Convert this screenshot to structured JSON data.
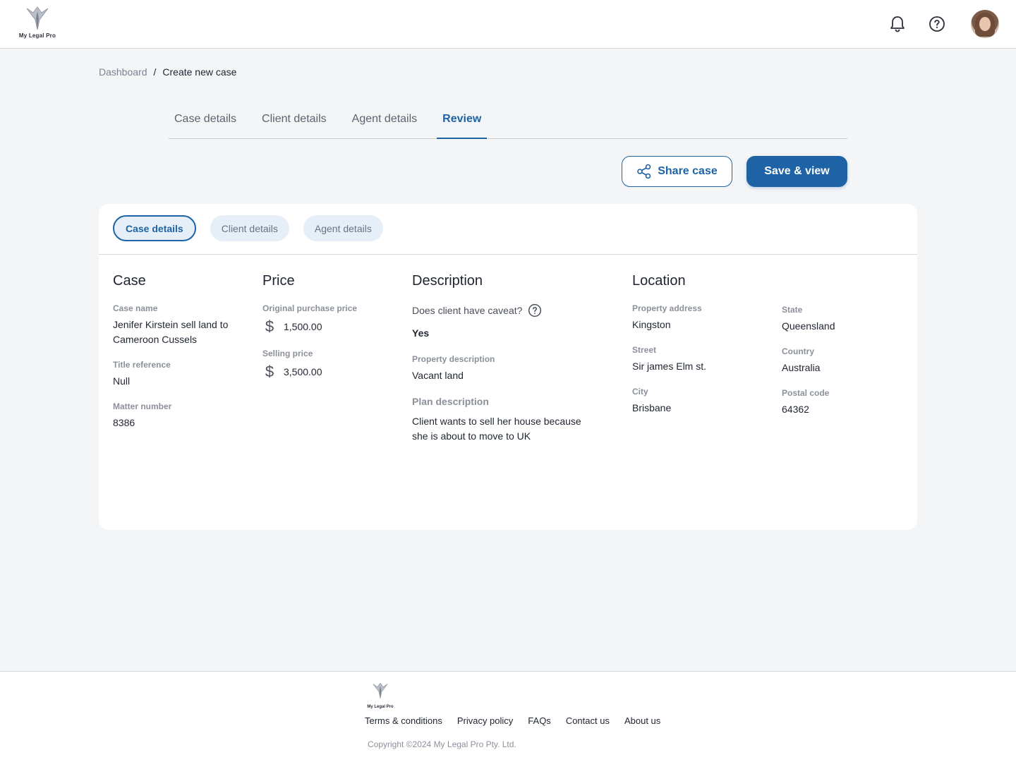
{
  "header": {
    "logo_text": "My Legal Pro",
    "icons": [
      "bell-icon",
      "help-icon",
      "avatar"
    ]
  },
  "breadcrumb": {
    "parent": "Dashboard",
    "separator": "/",
    "current": "Create new case"
  },
  "tabs": [
    {
      "label": "Case details",
      "active": false
    },
    {
      "label": "Client details",
      "active": false
    },
    {
      "label": "Agent details",
      "active": false
    },
    {
      "label": "Review",
      "active": true
    }
  ],
  "actions": {
    "share_label": "Share case",
    "save_label": "Save & view"
  },
  "card": {
    "pills": [
      {
        "label": "Case details",
        "active": true
      },
      {
        "label": "Client details",
        "active": false
      },
      {
        "label": "Agent details",
        "active": false
      }
    ],
    "case": {
      "heading": "Case",
      "case_name_label": "Case name",
      "case_name": "Jenifer Kirstein sell land to Cameroon Cussels",
      "title_ref_label": "Title reference",
      "title_ref": "Null",
      "matter_label": "Matter number",
      "matter": "8386"
    },
    "price": {
      "heading": "Price",
      "currency_symbol": "$",
      "original_label": "Original purchase price",
      "original": "1,500.00",
      "selling_label": "Selling price",
      "selling": "3,500.00"
    },
    "description": {
      "heading": "Description",
      "caveat_question": "Does client have caveat?",
      "caveat_answer": "Yes",
      "property_desc_label": "Property description",
      "property_desc": "Vacant land",
      "plan_label": "Plan description",
      "plan": "Client wants to sell her house because she is about to move to UK"
    },
    "location": {
      "heading": "Location",
      "address_label": "Property address",
      "address": "Kingston",
      "street_label": "Street",
      "street": "Sir james Elm st.",
      "city_label": "City",
      "city": "Brisbane",
      "state_label": "State",
      "state": "Queensland",
      "country_label": "Country",
      "country": "Australia",
      "postal_label": "Postal code",
      "postal": "64362"
    }
  },
  "footer": {
    "logo_text": "My Legal Pro",
    "links": [
      "Terms & conditions",
      "Privacy policy",
      "FAQs",
      "Contact us",
      "About us"
    ],
    "copyright": "Copyright ©2024 My Legal Pro Pty. Ltd."
  },
  "colors": {
    "primary": "#1d63a6",
    "background": "#f4f5f7",
    "pill_bg": "#e6eef8",
    "muted_text": "#8b909b"
  }
}
